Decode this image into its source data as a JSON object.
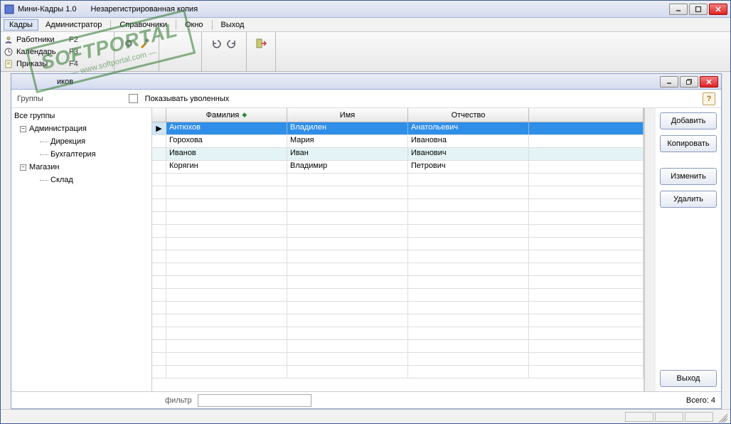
{
  "window": {
    "title": "Мини-Кадры 1.0",
    "subtitle": "Незарегистрированная копия"
  },
  "menubar": {
    "items": [
      "Кадры",
      "Администратор",
      "Справочники",
      "Окно",
      "Выход"
    ]
  },
  "toolbar": {
    "submenu": [
      {
        "label": "Работники",
        "hotkey": "F2"
      },
      {
        "label": "Календарь",
        "hotkey": "F3"
      },
      {
        "label": "Приказы",
        "hotkey": "F4"
      }
    ]
  },
  "inner": {
    "title": "иков",
    "group_label": "Группы",
    "show_fired_label": "Показывать уволенных",
    "help_label": "?"
  },
  "tree": {
    "root": "Все группы",
    "nodes": [
      {
        "label": "Администрация",
        "children": [
          "Дирекция",
          "Бухгалтерия"
        ]
      },
      {
        "label": "Магазин",
        "children": [
          "Склад"
        ]
      }
    ]
  },
  "grid": {
    "columns": [
      "Фамилия",
      "Имя",
      "Отчество"
    ],
    "rows": [
      {
        "cells": [
          "Антюхов",
          "Владилен",
          "Анатольевич"
        ],
        "selected": true
      },
      {
        "cells": [
          "Горохова",
          "Мария",
          "Ивановна"
        ],
        "alt": false
      },
      {
        "cells": [
          "Иванов",
          "Иван",
          "Иванович"
        ],
        "alt": true
      },
      {
        "cells": [
          "Корягин",
          "Владимир",
          "Петрович"
        ],
        "alt": false
      }
    ]
  },
  "buttons": {
    "add": "Добавить",
    "copy": "Копировать",
    "edit": "Изменить",
    "delete": "Удалить",
    "exit": "Выход"
  },
  "footer": {
    "filter_label": "фильтр",
    "total_label": "Всего: 4"
  },
  "watermark": {
    "brand": "SOFTPORTAL",
    "url": "— www.softportal.com —"
  }
}
